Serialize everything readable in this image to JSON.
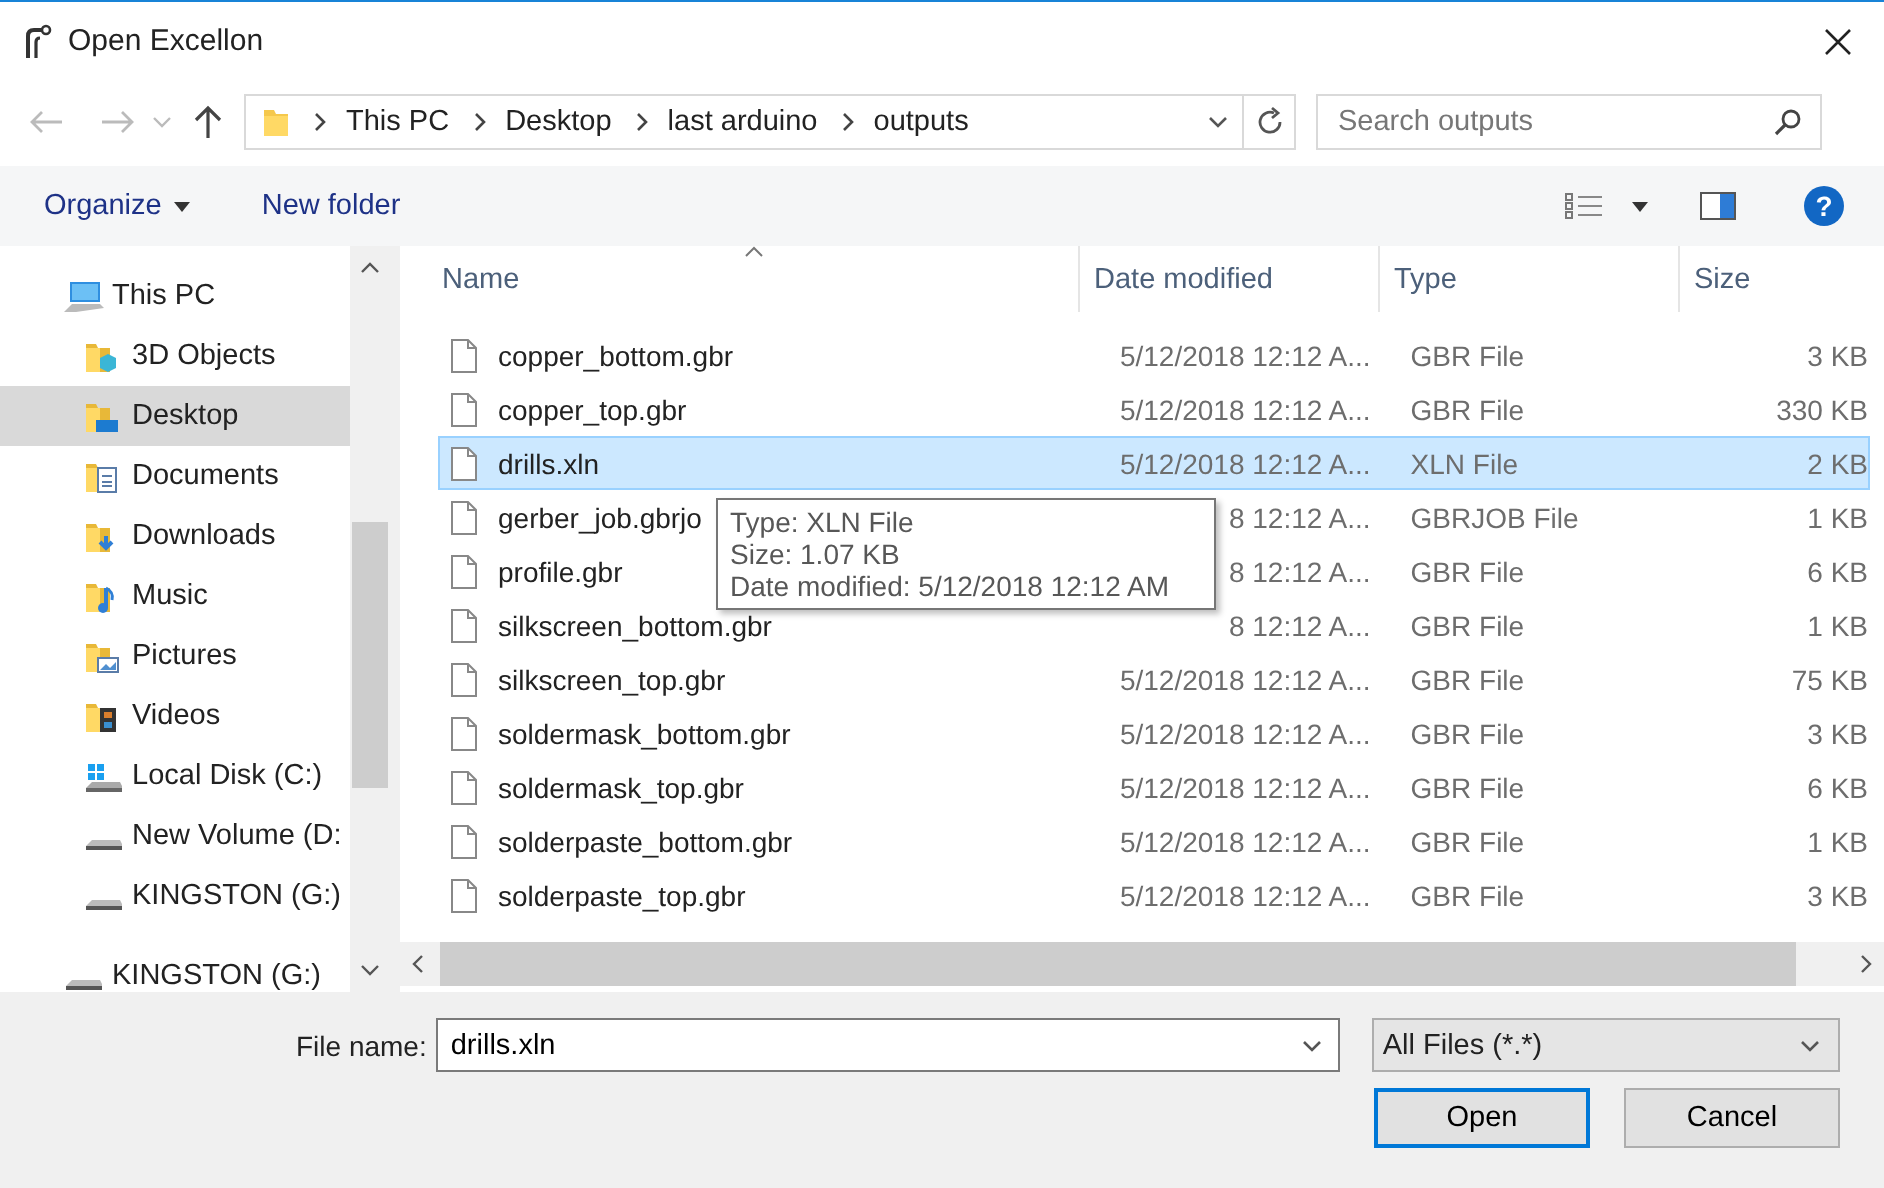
{
  "window": {
    "title": "Open Excellon"
  },
  "address": {
    "path": [
      "This PC",
      "Desktop",
      "last arduino",
      "outputs"
    ]
  },
  "search": {
    "placeholder": "Search outputs"
  },
  "toolbar": {
    "organize": "Organize",
    "new_folder": "New folder",
    "help": "?"
  },
  "nav": {
    "items": [
      {
        "label": "This PC",
        "kind": "pc",
        "selected": false,
        "children": [
          {
            "label": "3D Objects",
            "kind": "objects",
            "selected": false
          },
          {
            "label": "Desktop",
            "kind": "desktop",
            "selected": true
          },
          {
            "label": "Documents",
            "kind": "documents",
            "selected": false
          },
          {
            "label": "Downloads",
            "kind": "downloads",
            "selected": false
          },
          {
            "label": "Music",
            "kind": "music",
            "selected": false
          },
          {
            "label": "Pictures",
            "kind": "pictures",
            "selected": false
          },
          {
            "label": "Videos",
            "kind": "videos",
            "selected": false
          },
          {
            "label": "Local Disk (C:)",
            "kind": "system_drive",
            "selected": false
          },
          {
            "label": "New Volume (D:",
            "kind": "drive",
            "selected": false
          },
          {
            "label": "KINGSTON (G:)",
            "kind": "drive",
            "selected": false
          }
        ]
      },
      {
        "label": "KINGSTON (G:)",
        "kind": "drive",
        "selected": false
      }
    ]
  },
  "table": {
    "columns": [
      "Name",
      "Date modified",
      "Type",
      "Size"
    ],
    "rows": [
      {
        "name": "copper_bottom.gbr",
        "date": "5/12/2018 12:12 A...",
        "type": "GBR File",
        "size": "3 KB",
        "selected": false
      },
      {
        "name": "copper_top.gbr",
        "date": "5/12/2018 12:12 A...",
        "type": "GBR File",
        "size": "330 KB",
        "selected": false
      },
      {
        "name": "drills.xln",
        "date": "5/12/2018 12:12 A...",
        "type": "XLN File",
        "size": "2 KB",
        "selected": true
      },
      {
        "name": "gerber_job.gbrjo",
        "date": "8 12:12 A...",
        "type": "GBRJOB File",
        "size": "1 KB",
        "selected": false
      },
      {
        "name": "profile.gbr",
        "date": "8 12:12 A...",
        "type": "GBR File",
        "size": "6 KB",
        "selected": false
      },
      {
        "name": "silkscreen_bottom.gbr",
        "date": "8 12:12 A...",
        "type": "GBR File",
        "size": "1 KB",
        "selected": false
      },
      {
        "name": "silkscreen_top.gbr",
        "date": "5/12/2018 12:12 A...",
        "type": "GBR File",
        "size": "75 KB",
        "selected": false
      },
      {
        "name": "soldermask_bottom.gbr",
        "date": "5/12/2018 12:12 A...",
        "type": "GBR File",
        "size": "3 KB",
        "selected": false
      },
      {
        "name": "soldermask_top.gbr",
        "date": "5/12/2018 12:12 A...",
        "type": "GBR File",
        "size": "6 KB",
        "selected": false
      },
      {
        "name": "solderpaste_bottom.gbr",
        "date": "5/12/2018 12:12 A...",
        "type": "GBR File",
        "size": "1 KB",
        "selected": false
      },
      {
        "name": "solderpaste_top.gbr",
        "date": "5/12/2018 12:12 A...",
        "type": "GBR File",
        "size": "3 KB",
        "selected": false
      }
    ]
  },
  "tooltip": {
    "lines": [
      "Type: XLN File",
      "Size: 1.07 KB",
      "Date modified: 5/12/2018 12:12 AM"
    ]
  },
  "file_name": {
    "label": "File name:",
    "value": "drills.xln"
  },
  "file_type": {
    "value": "All Files (*.*)"
  },
  "buttons": [
    {
      "label": "Open",
      "default": true
    },
    {
      "label": "Cancel",
      "default": false
    }
  ]
}
